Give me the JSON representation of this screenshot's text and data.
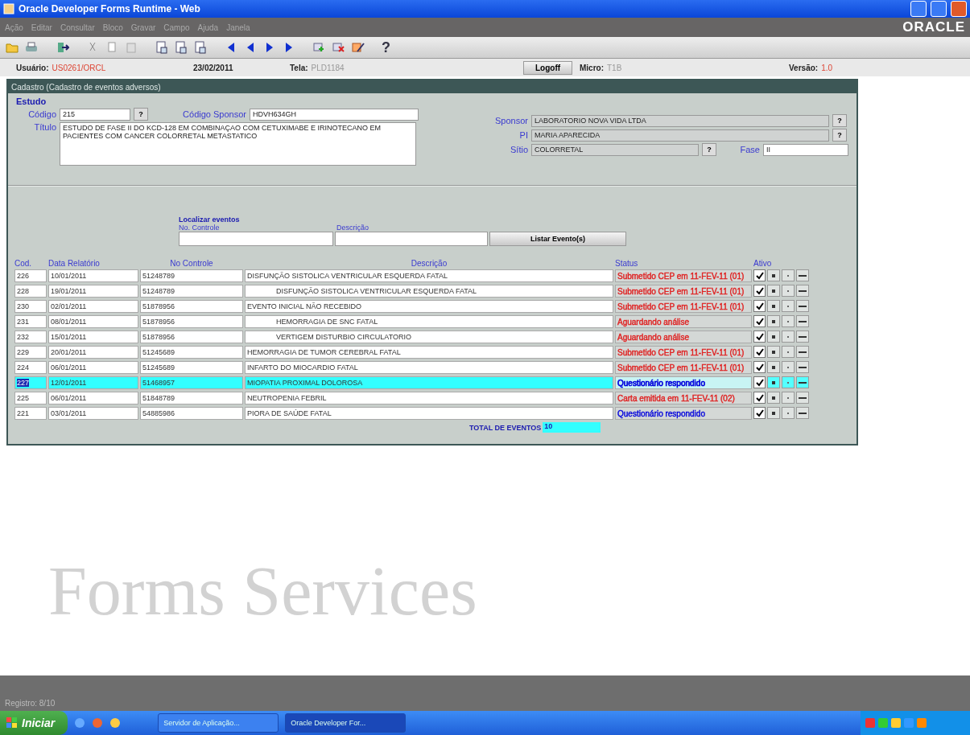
{
  "window": {
    "title": "Oracle Developer Forms Runtime - Web"
  },
  "menu": [
    "Ação",
    "Editar",
    "Consultar",
    "Bloco",
    "Gravar",
    "Campo",
    "Ajuda",
    "Janela"
  ],
  "brand": "ORACLE",
  "toolbar": {
    "help": "?"
  },
  "info_bar": {
    "user_label": "Usuário:",
    "user": "US0261/ORCL",
    "date": "23/02/2011",
    "screen_label": "Tela:",
    "screen": "PLD1184",
    "logoff": "Logoff",
    "micro_label": "Micro:",
    "micro": "T1B",
    "version_label": "Versão:",
    "version": "1.0"
  },
  "panel": {
    "title": "Cadastro  (Cadastro de eventos adversos)"
  },
  "study": {
    "heading": "Estudo",
    "code_label": "Código",
    "code": "215",
    "lov": "?",
    "sponsor_code_label": "Código Sponsor",
    "sponsor_code": "HDVH634GH",
    "title_label": "Título",
    "title": "ESTUDO DE FASE II DO KCD-128 EM COMBINAÇAO COM CETUXIMABE E IRINOTECANO EM PACIENTES COM CANCER COLORRETAL METASTATICO",
    "sponsor_label": "Sponsor",
    "sponsor": "LABORATORIO NOVA VIDA LTDA",
    "pi_label": "PI",
    "pi": "MARIA APARECIDA",
    "site_label": "Sítio",
    "site": "COLORRETAL",
    "phase_label": "Fase",
    "phase": "II"
  },
  "search": {
    "heading": "Localizar eventos",
    "control_label": "No. Controle",
    "description_label": "Descrição",
    "button": "Listar Evento(s)"
  },
  "table": {
    "columns": [
      "Cod.",
      "Data Relatório",
      "No Controle",
      "Descrição",
      "Status",
      "Ativo"
    ],
    "rows": [
      {
        "cod": "226",
        "date": "10/01/2011",
        "control": "51248789",
        "description": "DISFUNÇÃO SISTOLICA  VENTRICULAR ESQUERDA FATAL",
        "status": "Submetido CEP em 11-FEV-11 (01)",
        "color": "#e02020",
        "active": true,
        "selected": false,
        "children": [
          {
            "cod": "228",
            "date": "19/01/2011",
            "control": "51248789",
            "description": "DISFUNÇÃO SISTOLICA  VENTRICULAR ESQUERDA FATAL",
            "status": "Submetido CEP em 11-FEV-11 (01)",
            "color": "#e02020",
            "active": true,
            "selected": false
          }
        ]
      },
      {
        "cod": "230",
        "date": "02/01/2011",
        "control": "51878956",
        "description": "EVENTO INICIAL NÃO RECEBIDO",
        "status": "Submetido CEP em 11-FEV-11 (01)",
        "color": "#e02020",
        "active": true,
        "selected": false,
        "children": [
          {
            "cod": "231",
            "date": "08/01/2011",
            "control": "51878956",
            "description": "HEMORRAGIA DE SNC FATAL",
            "status": "Aguardando análise",
            "color": "#e02020",
            "active": true,
            "selected": false
          },
          {
            "cod": "232",
            "date": "15/01/2011",
            "control": "51878956",
            "description": "VERTIGEM DISTURBIO CIRCULATORIO",
            "status": "Aguardando análise",
            "color": "#e02020",
            "active": true,
            "selected": false
          }
        ]
      },
      {
        "cod": "229",
        "date": "20/01/2011",
        "control": "51245689",
        "description": "HEMORRAGIA DE TUMOR CEREBRAL FATAL",
        "status": "Submetido CEP em 11-FEV-11 (01)",
        "color": "#e02020",
        "active": true,
        "selected": false
      },
      {
        "cod": "224",
        "date": "06/01/2011",
        "control": "51245689",
        "description": "INFARTO DO MIOCARDIO FATAL",
        "status": "Submetido CEP em 11-FEV-11 (01)",
        "color": "#e02020",
        "active": true,
        "selected": false
      },
      {
        "cod": "227",
        "date": "12/01/2011",
        "control": "51468957",
        "description": "MIOPATIA PROXIMAL DOLOROSA",
        "status": "Questionário respondido",
        "color": "#0000dd",
        "active": true,
        "selected": true
      },
      {
        "cod": "225",
        "date": "06/01/2011",
        "control": "51848789",
        "description": "NEUTROPENIA FEBRIL",
        "status": "Carta emitida em 11-FEV-11 (02)",
        "color": "#e02020",
        "active": true,
        "selected": false
      },
      {
        "cod": "221",
        "date": "03/01/2011",
        "control": "54885986",
        "description": "PIORA DE SAÚDE FATAL",
        "status": "Questionário respondido",
        "color": "#0000dd",
        "active": true,
        "selected": false
      }
    ]
  },
  "total": {
    "label": "TOTAL DE EVENTOS",
    "value": "10"
  },
  "background_text": "Forms Services",
  "status_bar": {
    "record": "Registro: 8/10"
  },
  "taskbar": {
    "start": "Iniciar",
    "items": [
      {
        "label": "Servidor de Aplicação...",
        "selected": false
      },
      {
        "label": "Oracle Developer For...",
        "selected": true
      }
    ]
  }
}
